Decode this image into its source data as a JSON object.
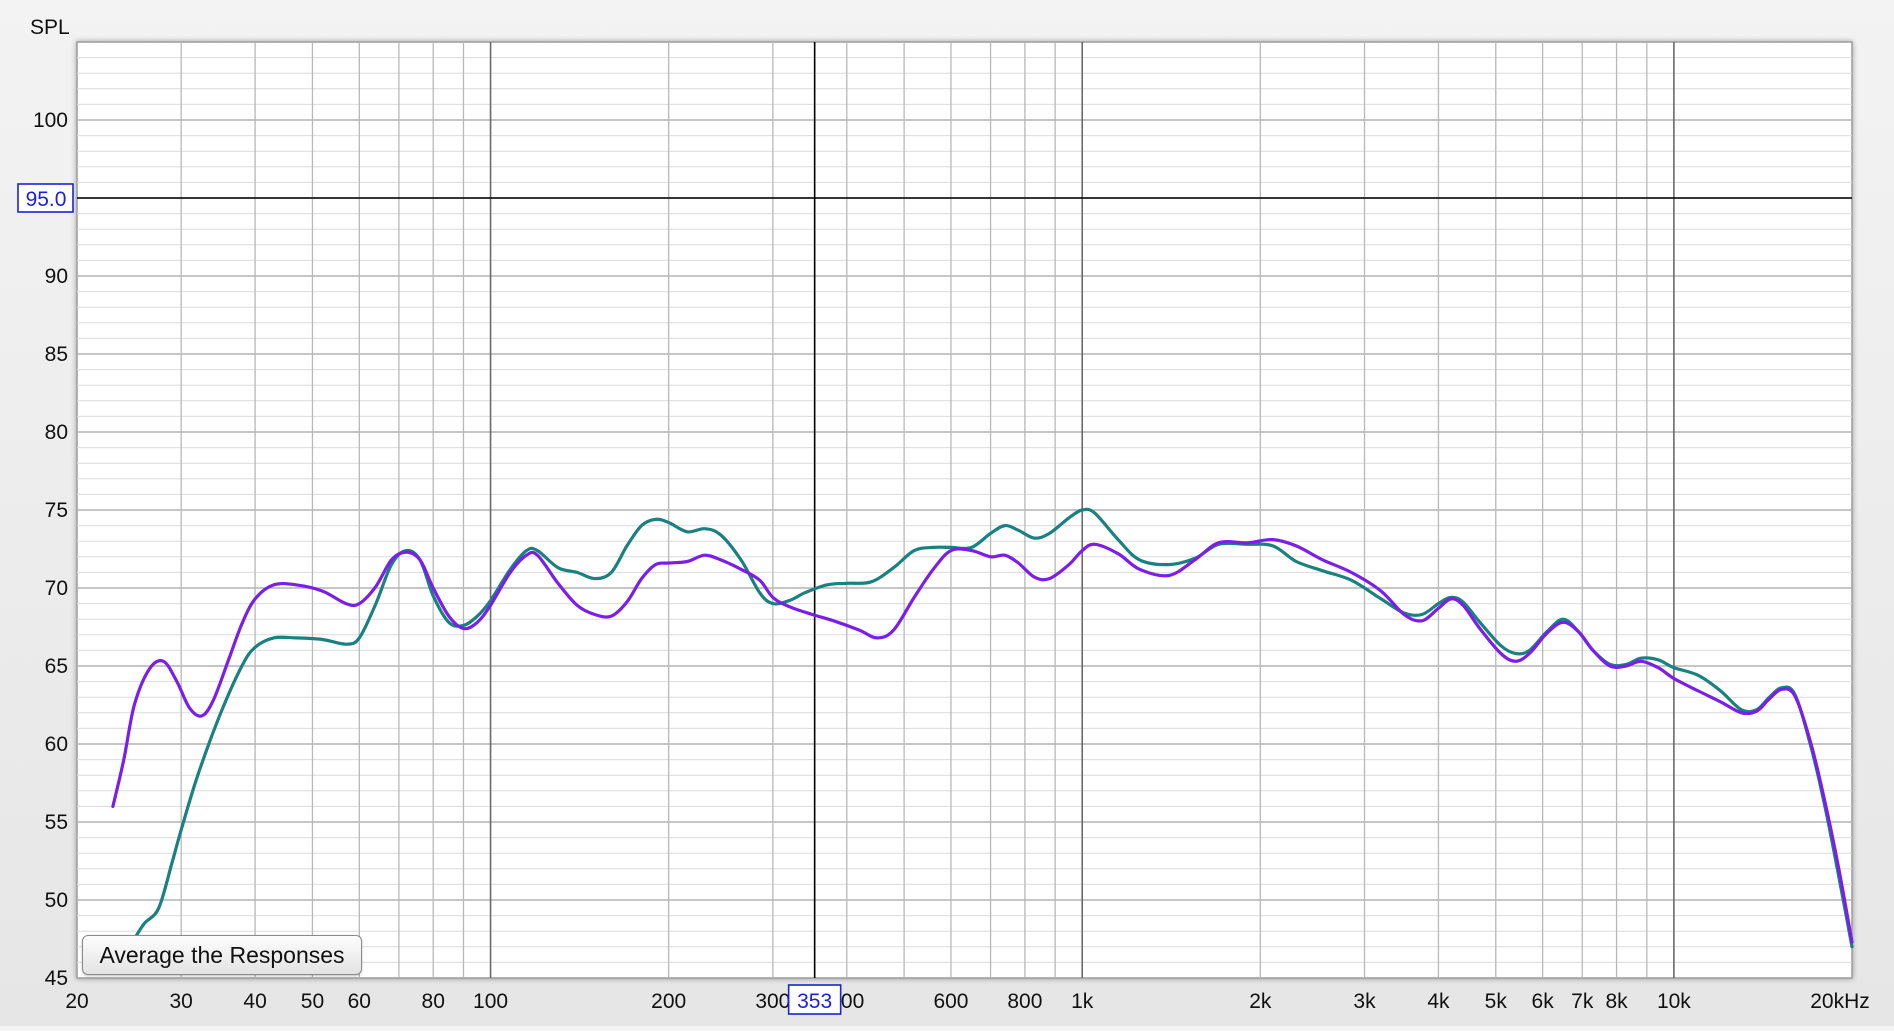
{
  "chart_data": {
    "type": "line",
    "x_scale": "log",
    "xlim": [
      20,
      20000
    ],
    "ylim": [
      45,
      105
    ],
    "ylabel": "SPL",
    "x_unit": "kHz",
    "grid": true,
    "y_ticks": [
      {
        "value": 45,
        "label": "45"
      },
      {
        "value": 50,
        "label": "50"
      },
      {
        "value": 55,
        "label": "55"
      },
      {
        "value": 60,
        "label": "60"
      },
      {
        "value": 65,
        "label": "65"
      },
      {
        "value": 70,
        "label": "70"
      },
      {
        "value": 75,
        "label": "75"
      },
      {
        "value": 80,
        "label": "80"
      },
      {
        "value": 85,
        "label": "85"
      },
      {
        "value": 90,
        "label": "90"
      },
      {
        "value": 100,
        "label": "100"
      }
    ],
    "x_ticks": [
      {
        "value": 20,
        "label": "20"
      },
      {
        "value": 30,
        "label": "30"
      },
      {
        "value": 40,
        "label": "40"
      },
      {
        "value": 50,
        "label": "50"
      },
      {
        "value": 60,
        "label": "60"
      },
      {
        "value": 80,
        "label": "80"
      },
      {
        "value": 100,
        "label": "100"
      },
      {
        "value": 200,
        "label": "200"
      },
      {
        "value": 300,
        "label": "300"
      },
      {
        "value": 400,
        "label": "400"
      },
      {
        "value": 600,
        "label": "600"
      },
      {
        "value": 800,
        "label": "800"
      },
      {
        "value": 1000,
        "label": "1k"
      },
      {
        "value": 2000,
        "label": "2k"
      },
      {
        "value": 3000,
        "label": "3k"
      },
      {
        "value": 4000,
        "label": "4k"
      },
      {
        "value": 5000,
        "label": "5k"
      },
      {
        "value": 6000,
        "label": "6k"
      },
      {
        "value": 7000,
        "label": "7k"
      },
      {
        "value": 8000,
        "label": "8k"
      },
      {
        "value": 10000,
        "label": "10k"
      },
      {
        "value": 20000,
        "label": "20kHz"
      }
    ],
    "cursor": {
      "x": 353,
      "y": 95.0,
      "x_label": "353",
      "y_label": "95.0"
    },
    "series": [
      {
        "color": "#1a8080",
        "points": [
          [
            25,
            47.5
          ],
          [
            26,
            48.5
          ],
          [
            27.5,
            49.5
          ],
          [
            29,
            52.5
          ],
          [
            30,
            54.5
          ],
          [
            32,
            58
          ],
          [
            35,
            62
          ],
          [
            38,
            65
          ],
          [
            40,
            66.2
          ],
          [
            43,
            66.8
          ],
          [
            47,
            66.8
          ],
          [
            52,
            66.7
          ],
          [
            57,
            66.4
          ],
          [
            60,
            66.8
          ],
          [
            64,
            69
          ],
          [
            68,
            71.5
          ],
          [
            72,
            72.4
          ],
          [
            76,
            71.8
          ],
          [
            80,
            69.5
          ],
          [
            85,
            67.8
          ],
          [
            90,
            67.6
          ],
          [
            95,
            68.2
          ],
          [
            100,
            69.2
          ],
          [
            108,
            71.2
          ],
          [
            115,
            72.4
          ],
          [
            120,
            72.4
          ],
          [
            130,
            71.3
          ],
          [
            140,
            71
          ],
          [
            150,
            70.6
          ],
          [
            160,
            71
          ],
          [
            170,
            72.7
          ],
          [
            180,
            74
          ],
          [
            190,
            74.4
          ],
          [
            200,
            74.2
          ],
          [
            215,
            73.6
          ],
          [
            230,
            73.8
          ],
          [
            245,
            73.4
          ],
          [
            265,
            71.8
          ],
          [
            285,
            69.7
          ],
          [
            300,
            69
          ],
          [
            320,
            69.2
          ],
          [
            340,
            69.7
          ],
          [
            370,
            70.2
          ],
          [
            400,
            70.3
          ],
          [
            440,
            70.4
          ],
          [
            480,
            71.3
          ],
          [
            520,
            72.4
          ],
          [
            560,
            72.6
          ],
          [
            600,
            72.6
          ],
          [
            650,
            72.6
          ],
          [
            700,
            73.5
          ],
          [
            740,
            74
          ],
          [
            780,
            73.7
          ],
          [
            830,
            73.2
          ],
          [
            880,
            73.5
          ],
          [
            950,
            74.5
          ],
          [
            1000,
            75
          ],
          [
            1050,
            74.8
          ],
          [
            1150,
            73.1
          ],
          [
            1250,
            71.8
          ],
          [
            1400,
            71.5
          ],
          [
            1550,
            71.9
          ],
          [
            1700,
            72.8
          ],
          [
            1900,
            72.8
          ],
          [
            2100,
            72.7
          ],
          [
            2300,
            71.7
          ],
          [
            2550,
            71.1
          ],
          [
            2850,
            70.5
          ],
          [
            3200,
            69.3
          ],
          [
            3500,
            68.4
          ],
          [
            3750,
            68.3
          ],
          [
            4000,
            69
          ],
          [
            4200,
            69.4
          ],
          [
            4400,
            69.1
          ],
          [
            4700,
            67.8
          ],
          [
            5100,
            66.3
          ],
          [
            5400,
            65.8
          ],
          [
            5700,
            66
          ],
          [
            6100,
            67.2
          ],
          [
            6500,
            68
          ],
          [
            6900,
            67.2
          ],
          [
            7300,
            66
          ],
          [
            7800,
            65.1
          ],
          [
            8300,
            65.1
          ],
          [
            8800,
            65.5
          ],
          [
            9400,
            65.4
          ],
          [
            10000,
            64.9
          ],
          [
            11000,
            64.4
          ],
          [
            12000,
            63.4
          ],
          [
            13000,
            62.2
          ],
          [
            13800,
            62.2
          ],
          [
            14500,
            63
          ],
          [
            15200,
            63.6
          ],
          [
            16000,
            63.2
          ],
          [
            17000,
            60
          ],
          [
            18000,
            56
          ],
          [
            19000,
            51.5
          ],
          [
            20000,
            47
          ]
        ]
      },
      {
        "color": "#7a1ee8",
        "points": [
          [
            23,
            56
          ],
          [
            24,
            59
          ],
          [
            25,
            62.5
          ],
          [
            26.5,
            64.8
          ],
          [
            28,
            65.3
          ],
          [
            29.5,
            64
          ],
          [
            31,
            62.3
          ],
          [
            32.5,
            61.8
          ],
          [
            34,
            62.8
          ],
          [
            36,
            65.3
          ],
          [
            38,
            67.7
          ],
          [
            40,
            69.3
          ],
          [
            43,
            70.2
          ],
          [
            47,
            70.2
          ],
          [
            52,
            69.8
          ],
          [
            57,
            69
          ],
          [
            60,
            69
          ],
          [
            64,
            70.1
          ],
          [
            68,
            71.8
          ],
          [
            72,
            72.3
          ],
          [
            76,
            71.8
          ],
          [
            80,
            70
          ],
          [
            85,
            68.2
          ],
          [
            90,
            67.4
          ],
          [
            95,
            67.8
          ],
          [
            100,
            68.9
          ],
          [
            108,
            71
          ],
          [
            115,
            72.1
          ],
          [
            120,
            72.1
          ],
          [
            130,
            70.3
          ],
          [
            140,
            68.9
          ],
          [
            150,
            68.3
          ],
          [
            160,
            68.2
          ],
          [
            170,
            69.1
          ],
          [
            180,
            70.6
          ],
          [
            190,
            71.5
          ],
          [
            200,
            71.6
          ],
          [
            215,
            71.7
          ],
          [
            230,
            72.1
          ],
          [
            245,
            71.8
          ],
          [
            265,
            71.2
          ],
          [
            285,
            70.5
          ],
          [
            300,
            69.4
          ],
          [
            320,
            68.8
          ],
          [
            350,
            68.3
          ],
          [
            380,
            67.9
          ],
          [
            420,
            67.3
          ],
          [
            450,
            66.8
          ],
          [
            480,
            67.3
          ],
          [
            520,
            69.4
          ],
          [
            560,
            71.2
          ],
          [
            600,
            72.4
          ],
          [
            650,
            72.4
          ],
          [
            700,
            72
          ],
          [
            740,
            72.1
          ],
          [
            780,
            71.6
          ],
          [
            830,
            70.7
          ],
          [
            880,
            70.6
          ],
          [
            950,
            71.5
          ],
          [
            1000,
            72.4
          ],
          [
            1050,
            72.8
          ],
          [
            1150,
            72.2
          ],
          [
            1250,
            71.2
          ],
          [
            1400,
            70.8
          ],
          [
            1550,
            71.8
          ],
          [
            1700,
            72.9
          ],
          [
            1900,
            72.9
          ],
          [
            2100,
            73.1
          ],
          [
            2300,
            72.7
          ],
          [
            2550,
            71.8
          ],
          [
            2850,
            71
          ],
          [
            3200,
            69.8
          ],
          [
            3500,
            68.3
          ],
          [
            3750,
            67.9
          ],
          [
            4000,
            68.7
          ],
          [
            4200,
            69.3
          ],
          [
            4400,
            68.9
          ],
          [
            4700,
            67.4
          ],
          [
            5100,
            65.8
          ],
          [
            5400,
            65.3
          ],
          [
            5700,
            65.8
          ],
          [
            6100,
            67.1
          ],
          [
            6500,
            67.8
          ],
          [
            6900,
            67.2
          ],
          [
            7300,
            66
          ],
          [
            7800,
            65
          ],
          [
            8300,
            65
          ],
          [
            8800,
            65.3
          ],
          [
            9400,
            64.9
          ],
          [
            10000,
            64.2
          ],
          [
            11000,
            63.4
          ],
          [
            12000,
            62.7
          ],
          [
            13000,
            62
          ],
          [
            13800,
            62.1
          ],
          [
            14500,
            62.9
          ],
          [
            15200,
            63.5
          ],
          [
            16000,
            63.1
          ],
          [
            17000,
            60.2
          ],
          [
            18000,
            56.3
          ],
          [
            19000,
            52
          ],
          [
            20000,
            47.3
          ]
        ]
      }
    ]
  },
  "button": {
    "label": "Average the Responses"
  }
}
